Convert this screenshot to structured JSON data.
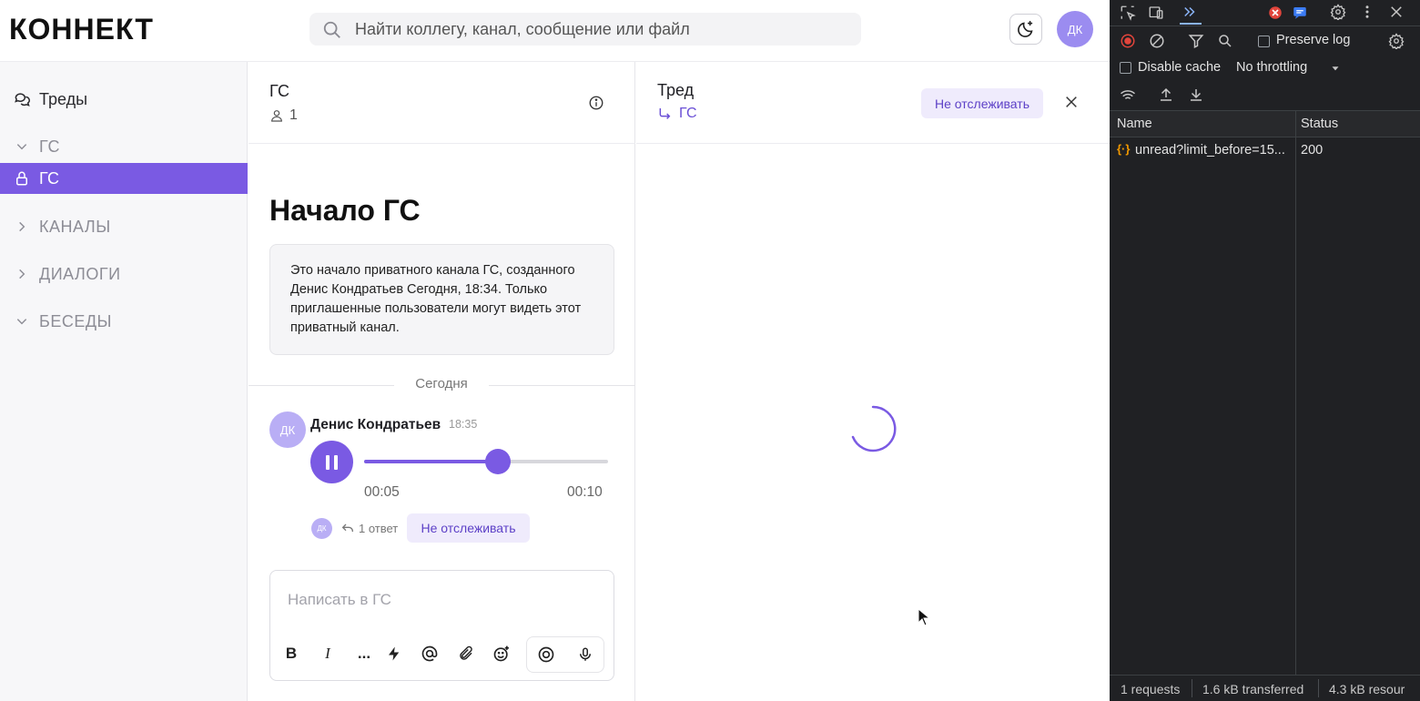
{
  "header": {
    "logo": "КОННЕКТ",
    "search_placeholder": "Найти коллегу, канал, сообщение или файл",
    "user_initials": "ДК"
  },
  "sidebar": {
    "threads_label": "Треды",
    "group_label": "ГС",
    "active_channel": "ГС",
    "sections": [
      "КАНАЛЫ",
      "ДИАЛОГИ",
      "БЕСЕДЫ"
    ]
  },
  "channel": {
    "title": "ГС",
    "member_count": "1",
    "start_title": "Начало ГС",
    "intro_text": "Это начало приватного канала ГС, созданного Денис Кондратьев Сегодня, 18:34. Только приглашенные пользователи могут видеть этот приватный канал.",
    "date_divider": "Сегодня",
    "message": {
      "avatar_initials": "ДК",
      "author": "Денис Кондратьев",
      "time": "18:35",
      "audio_current": "00:05",
      "audio_total": "00:10",
      "audio_progress": 0.55,
      "reply_avatar_initials": "ДК",
      "reply_count": "1 ответ",
      "unfollow_label": "Не отслеживать"
    },
    "composer_placeholder": "Написать в ГС",
    "toolbar": {
      "bold": "B",
      "italic": "I",
      "more": "..."
    }
  },
  "thread": {
    "title": "Тред",
    "channel_link": "ГС",
    "unfollow_label": "Не отслеживать"
  },
  "devtools": {
    "preserve_log": "Preserve log",
    "disable_cache": "Disable cache",
    "throttling": "No throttling",
    "columns": [
      "Name",
      "Status"
    ],
    "requests": [
      {
        "name": "unread?limit_before=15...",
        "status": "200"
      }
    ],
    "footer": {
      "requests": "1 requests",
      "transferred": "1.6 kB transferred",
      "resources": "4.3 kB resour"
    }
  },
  "colors": {
    "accent": "#7a5ae3",
    "accent_light": "#efebfc",
    "devtools_bg": "#202124"
  }
}
